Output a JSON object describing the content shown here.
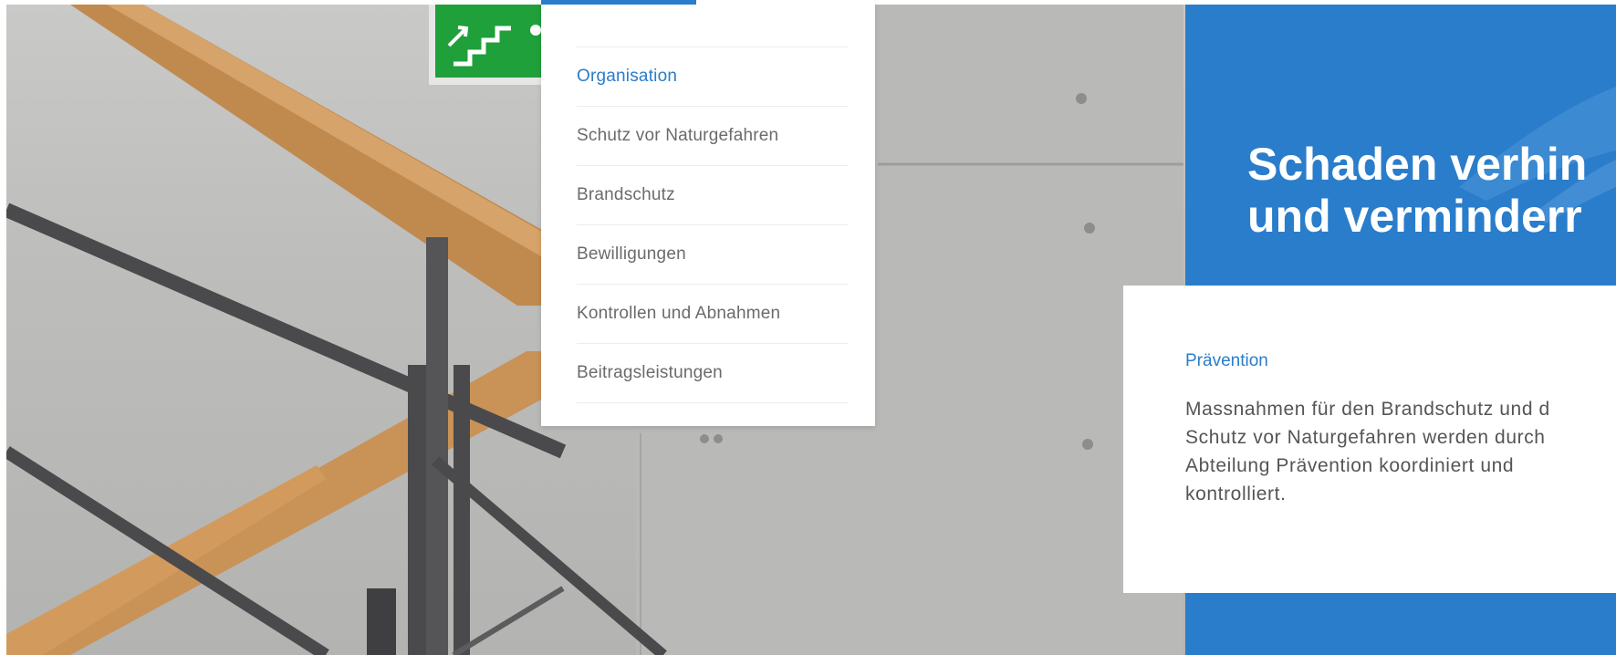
{
  "menu": {
    "items": [
      {
        "label": "Organisation",
        "active": true
      },
      {
        "label": "Schutz vor Naturgefahren",
        "active": false
      },
      {
        "label": "Brandschutz",
        "active": false
      },
      {
        "label": "Bewilligungen",
        "active": false
      },
      {
        "label": "Kontrollen und Abnahmen",
        "active": false
      },
      {
        "label": "Beitragsleistungen",
        "active": false
      }
    ]
  },
  "hero": {
    "headline_line1": "Schaden verhin",
    "headline_line2": "und verminderr"
  },
  "info": {
    "eyebrow": "Prävention",
    "body_lines": [
      "Massnahmen für den Brandschutz und d",
      "Schutz vor Naturgefahren werden durch",
      "Abteilung Prävention koordiniert und",
      "kontrolliert."
    ]
  },
  "colors": {
    "accent": "#2a7dca",
    "menu_text": "#6b6b6b",
    "exit_sign_green": "#1fa03a"
  },
  "icons": {
    "exit_sign": "emergency-exit-stairs-icon"
  }
}
